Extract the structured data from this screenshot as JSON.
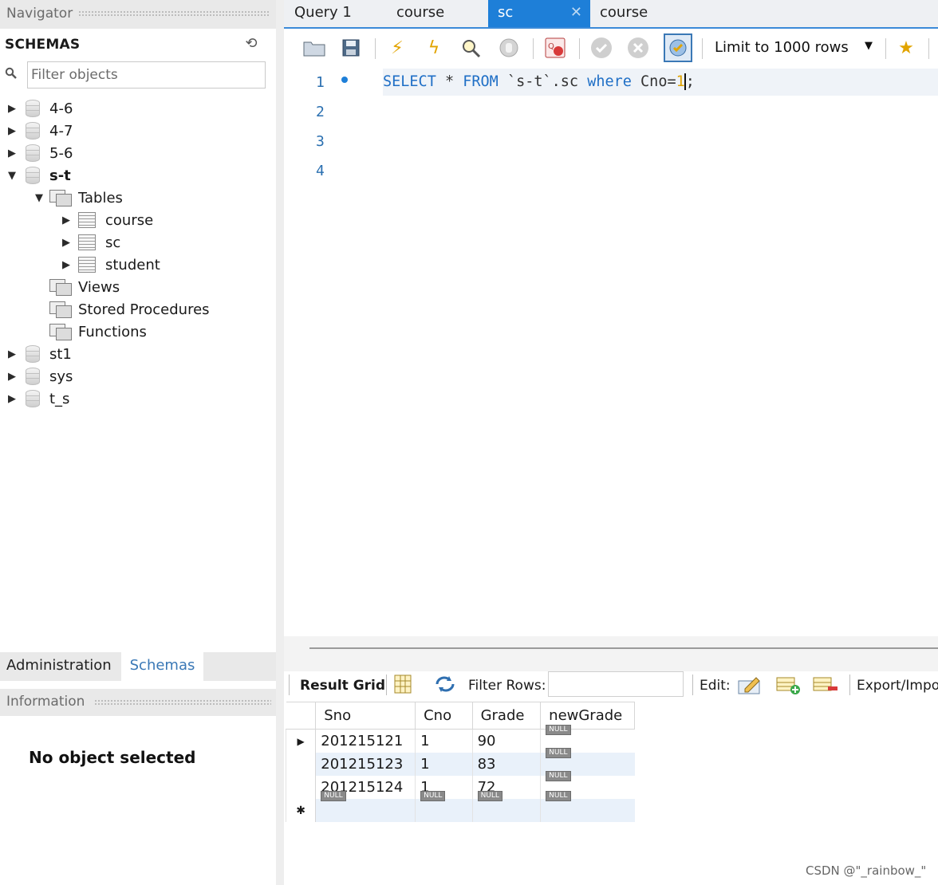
{
  "navigator": {
    "title": "Navigator",
    "schemas_title": "SCHEMAS",
    "filter_placeholder": "Filter objects",
    "tree": {
      "db1": "4-6",
      "db2": "4-7",
      "db3": "5-6",
      "db4": "s-t",
      "tables": "Tables",
      "table1": "course",
      "table2": "sc",
      "table3": "student",
      "views": "Views",
      "procedures": "Stored Procedures",
      "functions": "Functions",
      "db5": "st1",
      "db6": "sys",
      "db7": "t_s"
    },
    "bottom_tabs": {
      "administration": "Administration",
      "schemas": "Schemas"
    },
    "information_title": "Information",
    "no_object": "No object selected"
  },
  "editor_tabs": {
    "query1": "Query 1",
    "course1": "course",
    "sc": "sc",
    "course2": "course",
    "close": "✕"
  },
  "toolbar": {
    "limit_label": "Limit to 1000 rows"
  },
  "editor": {
    "line_numbers": [
      "1",
      "2",
      "3",
      "4"
    ],
    "sql": {
      "select": "SELECT",
      "star": " * ",
      "from": "FROM",
      "table": " `s-t`.sc ",
      "where": "where",
      "cond": " Cno=",
      "value": "1",
      "end": ";"
    }
  },
  "result_toolbar": {
    "result_grid": "Result Grid",
    "filter_rows": "Filter Rows:",
    "edit": "Edit:",
    "export": "Export/Impo"
  },
  "grid": {
    "columns": [
      "Sno",
      "Cno",
      "Grade",
      "newGrade"
    ],
    "rows": [
      [
        "201215121",
        "1",
        "90",
        "NULL"
      ],
      [
        "201215123",
        "1",
        "83",
        "NULL"
      ],
      [
        "201215124",
        "1",
        "72",
        "NULL"
      ]
    ],
    "new_row": [
      "NULL",
      "NULL",
      "NULL",
      "NULL"
    ]
  },
  "watermark": "CSDN @\"_rainbow_\"",
  "colors": {
    "accent": "#1e7fd8",
    "keyword": "#1f6fc6",
    "number": "#e0a300",
    "row_alt": "#e9f1fa"
  }
}
